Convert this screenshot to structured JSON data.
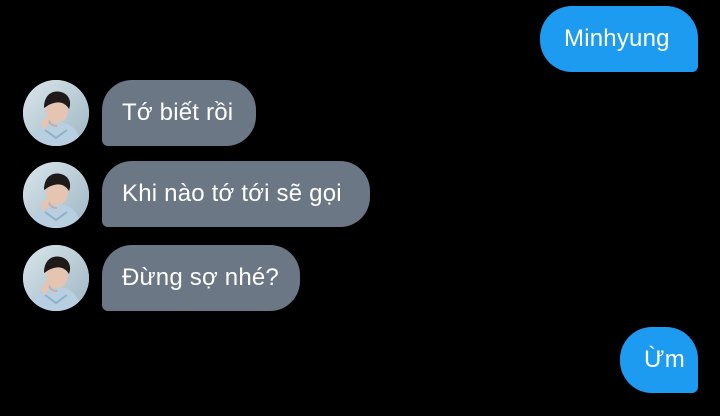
{
  "conversation": {
    "messages": [
      {
        "side": "sent",
        "text": "Minhyung"
      },
      {
        "side": "received",
        "text": "Tớ biết rồi",
        "has_avatar": true
      },
      {
        "side": "received",
        "text": "Khi nào tớ tới sẽ gọi",
        "has_avatar": true
      },
      {
        "side": "received",
        "text": "Đừng sợ nhé?",
        "has_avatar": true
      },
      {
        "side": "sent",
        "text": "Ừm"
      }
    ]
  },
  "colors": {
    "background": "#000000",
    "sent_bubble": "#1d9bf0",
    "received_bubble": "#6b7785",
    "text": "#ffffff"
  },
  "icons": {
    "avatar": "contact-photo-avatar"
  }
}
